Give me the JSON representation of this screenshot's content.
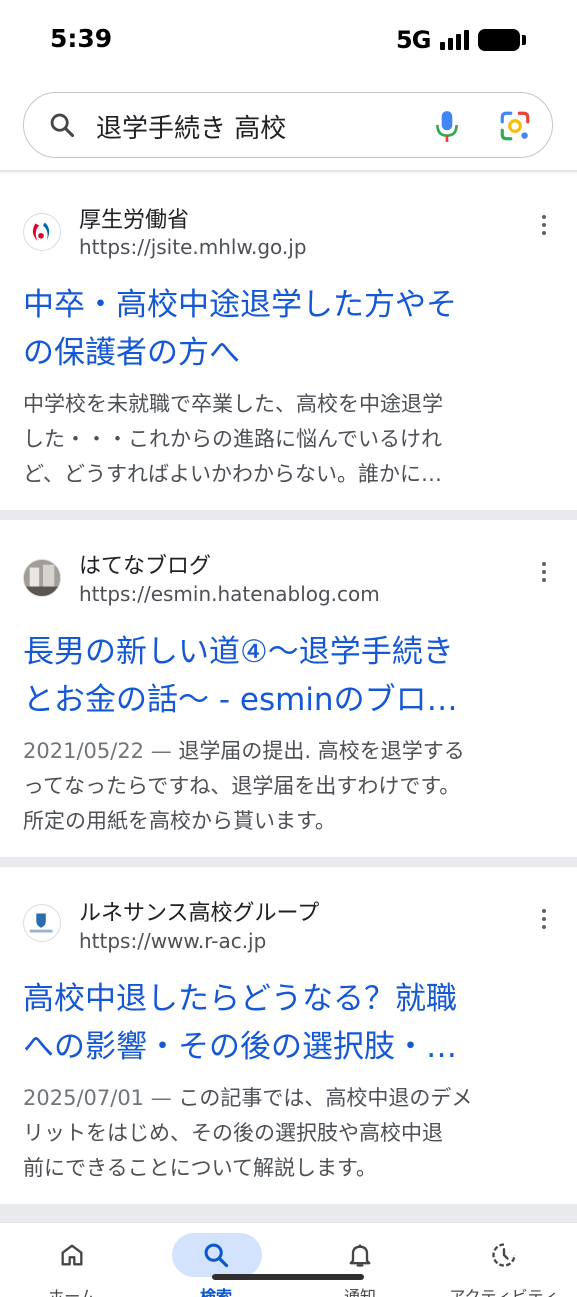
{
  "status_bar": {
    "time": "5:39",
    "network": "5G"
  },
  "search": {
    "query": "退学手続き 高校"
  },
  "results": [
    {
      "site_name": "厚生労働省",
      "url": "https://jsite.mhlw.go.jp",
      "title_lines": [
        "中卒・高校中途退学した方やそ",
        "の保護者の方へ"
      ],
      "date": "",
      "snippet_lines": [
        "中学校を未就職で卒業した、高校を中途退学",
        "した・・・これからの進路に悩んでいるけれ",
        "ど、どうすればよいかわからない。誰かに…"
      ]
    },
    {
      "site_name": "はてなブログ",
      "url": "https://esmin.hatenablog.com",
      "title_lines": [
        "長男の新しい道④〜退学手続き",
        "とお金の話〜 - esminのブロ…"
      ],
      "date": "2021/05/22 —",
      "snippet_lines": [
        " 退学届の提出. 高校を退学する",
        "ってなったらですね、退学届を出すわけです。",
        "所定の用紙を高校から貰います。"
      ]
    },
    {
      "site_name": "ルネサンス高校グループ",
      "url": "https://www.r-ac.jp",
      "title_lines": [
        "高校中退したらどうなる？就職",
        "への影響・その後の選択肢・…"
      ],
      "date": "2025/07/01 —",
      "snippet_lines": [
        " この記事では、高校中退のデメ",
        "リットをはじめ、その後の選択肢や高校中退",
        "前にできることについて解説します。"
      ]
    }
  ],
  "bottom_nav": [
    {
      "label": "ホーム",
      "icon": "home-icon"
    },
    {
      "label": "検索",
      "icon": "search-icon",
      "active": true
    },
    {
      "label": "通知",
      "icon": "bell-icon"
    },
    {
      "label": "アクティビティ",
      "icon": "activity-icon"
    }
  ],
  "colors": {
    "link": "#1558d6",
    "nav_active_pill": "#d3e3fd",
    "separator": "#e8eaed"
  }
}
